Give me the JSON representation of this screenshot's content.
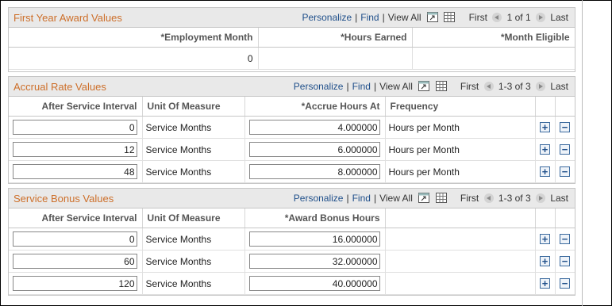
{
  "nav": {
    "personalize": "Personalize",
    "find": "Find",
    "view_all": "View All",
    "first": "First",
    "last": "Last"
  },
  "first_year": {
    "title": "First Year Award Values",
    "range": "1 of 1",
    "headers": [
      "*Employment Month",
      "*Hours Earned",
      "*Month Eligible"
    ],
    "rows": [
      [
        "0",
        "",
        ""
      ]
    ]
  },
  "accrual": {
    "title": "Accrual Rate Values",
    "range": "1-3 of 3",
    "headers": [
      "After Service Interval",
      "Unit Of Measure",
      "*Accrue Hours At",
      "Frequency"
    ],
    "rows": [
      {
        "interval": "0",
        "unit": "Service Months",
        "hours": "4.000000",
        "freq": "Hours per Month"
      },
      {
        "interval": "12",
        "unit": "Service Months",
        "hours": "6.000000",
        "freq": "Hours per Month"
      },
      {
        "interval": "48",
        "unit": "Service Months",
        "hours": "8.000000",
        "freq": "Hours per Month"
      }
    ]
  },
  "bonus": {
    "title": "Service Bonus Values",
    "range": "1-3 of 3",
    "headers": [
      "After Service Interval",
      "Unit Of Measure",
      "*Award Bonus Hours"
    ],
    "rows": [
      {
        "interval": "0",
        "unit": "Service Months",
        "hours": "16.000000"
      },
      {
        "interval": "60",
        "unit": "Service Months",
        "hours": "32.000000"
      },
      {
        "interval": "120",
        "unit": "Service Months",
        "hours": "40.000000"
      }
    ]
  },
  "colors": {
    "title": "#cd6f2a",
    "link": "#1f4f8a",
    "header_bg": "#e9e9e9"
  },
  "icons": {
    "zoom": "zoom-icon",
    "download": "grid-download-icon",
    "prev": "prev-arrow-icon",
    "next": "next-arrow-icon",
    "add": "add-row-icon",
    "delete": "delete-row-icon"
  }
}
